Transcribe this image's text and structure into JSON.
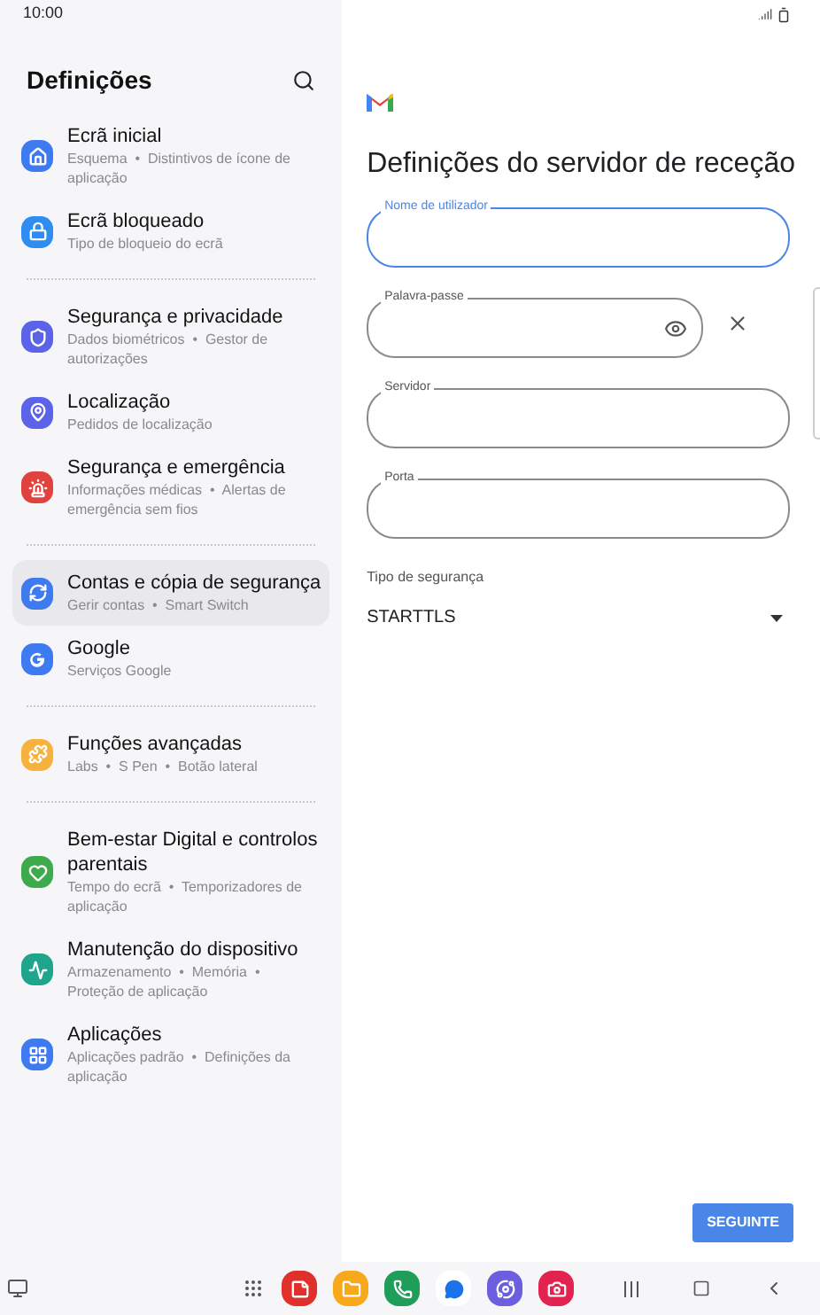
{
  "status_bar": {
    "time": "10:00"
  },
  "settings": {
    "title": "Definições",
    "groups": [
      {
        "items": [
          {
            "color": "#3e7bf0",
            "title": "Ecrã inicial",
            "subtitle": "Esquema  •  Distintivos de ícone de aplicação",
            "selected": false
          },
          {
            "color": "#2f8cf0",
            "title": "Ecrã bloqueado",
            "subtitle": "Tipo de bloqueio do ecrã",
            "selected": false
          }
        ]
      },
      {
        "items": [
          {
            "color": "#5b63e8",
            "title": "Segurança e privacidade",
            "subtitle": "Dados biométricos  •  Gestor de autorizações",
            "selected": false
          },
          {
            "color": "#5b63e8",
            "title": "Localização",
            "subtitle": "Pedidos de localização",
            "selected": false
          },
          {
            "color": "#e0433d",
            "title": "Segurança e emergência",
            "subtitle": "Informações médicas  •  Alertas de emergência sem fios",
            "selected": false
          }
        ]
      },
      {
        "items": [
          {
            "color": "#3e7bf0",
            "title": "Contas e cópia de segurança",
            "subtitle": "Gerir contas  •  Smart Switch",
            "selected": true
          },
          {
            "color": "#3e7bf0",
            "title": "Google",
            "subtitle": "Serviços Google",
            "selected": false
          }
        ]
      },
      {
        "items": [
          {
            "color": "#f6b23c",
            "title": "Funções avançadas",
            "subtitle": "Labs  •  S Pen  •  Botão lateral",
            "selected": false
          }
        ]
      },
      {
        "items": [
          {
            "color": "#3daa4b",
            "title": "Bem-estar Digital e controlos parentais",
            "subtitle": "Tempo do ecrã  •  Temporizadores de aplicação",
            "selected": false
          },
          {
            "color": "#1fa58c",
            "title": "Manutenção do dispositivo",
            "subtitle": "Armazenamento  •  Memória  •  Proteção de aplicação",
            "selected": false
          },
          {
            "color": "#3e7bf0",
            "title": "Aplicações",
            "subtitle": "Aplicações padrão  •  Definições da aplicação",
            "selected": false
          }
        ]
      }
    ]
  },
  "form": {
    "title": "Definições do servidor de receção",
    "fields": [
      {
        "kind": "text",
        "label": "Nome de utilizador",
        "focused": true
      },
      {
        "kind": "password",
        "label": "Palavra-passe",
        "focused": false
      },
      {
        "kind": "text",
        "label": "Servidor",
        "focused": false
      },
      {
        "kind": "text",
        "label": "Porta",
        "focused": false
      }
    ],
    "security": {
      "label": "Tipo de segurança",
      "value": "STARTTLS"
    },
    "next_button": "SEGUINTE"
  },
  "dock": {
    "apps": [
      {
        "color": "#e0302c"
      },
      {
        "color": "#f7a81b"
      },
      {
        "color": "#1f9e5a"
      },
      {
        "color": "#ffffff"
      },
      {
        "color": "#6b5fe0"
      },
      {
        "color": "#e2234f"
      }
    ]
  }
}
